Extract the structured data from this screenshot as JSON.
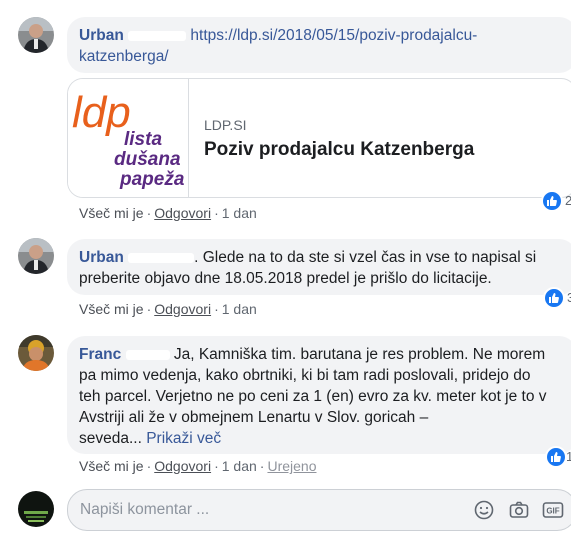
{
  "comments": [
    {
      "author": "Urban",
      "link_text": "https://ldp.si/2018/05/15/poziv-prodajalcu-katzenberga/",
      "link_line1": "https://ldp.si/2018/05/15/poziv-prodajalcu-",
      "link_line2": "katzenberga/",
      "preview": {
        "domain": "LDP.SI",
        "title": "Poziv prodajalcu Katzenberga",
        "logo_mark": "ldp",
        "logo_lines": [
          "lista",
          "dušana",
          "papeža"
        ]
      },
      "like_label": "Všeč mi je",
      "reply_label": "Odgovori",
      "time": "1 dan",
      "reaction_count": "2"
    },
    {
      "author": "Urban",
      "text_line1": ". Glede na to da ste si vzel čas in vse to napisal si",
      "text_line2": "preberite objavo dne 18.05.2018 predel je prišlo do licitacije.",
      "like_label": "Všeč mi je",
      "reply_label": "Odgovori",
      "time": "1 dan",
      "reaction_count": "3"
    },
    {
      "author": "Franc",
      "text_line1": "Ja, Kamniška tim. barutana je res problem. Ne morem",
      "text_line2": "pa mimo vedenja, kako obrtniki, ki bi tam radi poslovali, pridejo do",
      "text_line3": "teh parcel. Verjetno ne po ceni za 1 (en) evro za kv. meter kot je to v",
      "text_line4": "Avstriji ali že v obmejnem Lenartu v Slov. goricah –",
      "text_line5": "seveda...",
      "see_more": "Prikaži več",
      "like_label": "Všeč mi je",
      "reply_label": "Odgovori",
      "time": "1 dan",
      "edited": "Urejeno",
      "reaction_count": "1"
    }
  ],
  "composer": {
    "placeholder": "Napiši komentar ...",
    "icons": [
      "emoji-icon",
      "camera-icon",
      "gif-icon"
    ],
    "gif_label": "GIF"
  },
  "colors": {
    "link": "#385898",
    "bubble": "#f2f3f5",
    "like_blue": "#1877f2",
    "ldp_orange": "#e8601c",
    "ldp_purple": "#5a2a82"
  }
}
